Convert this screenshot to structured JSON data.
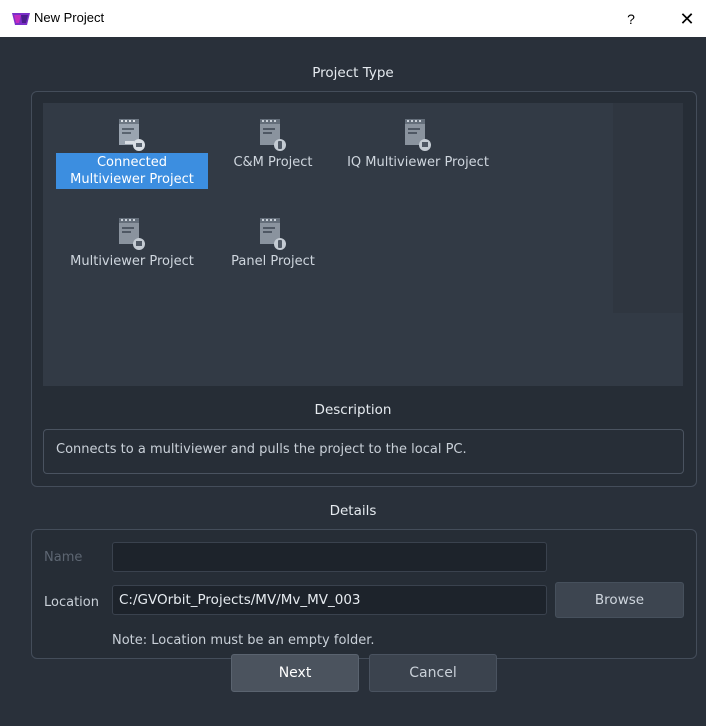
{
  "window": {
    "title": "New Project",
    "help_label": "?",
    "close_label": "✕"
  },
  "project_type": {
    "heading": "Project Type",
    "items": [
      {
        "label_line1": "Connected",
        "label_line2": "Multiviewer Project",
        "selected": true,
        "icon": "connected-document-icon"
      },
      {
        "label_line1": "C&M Project",
        "label_line2": "",
        "selected": false,
        "icon": "panel-document-icon"
      },
      {
        "label_line1": "IQ Multiviewer Project",
        "label_line2": "",
        "selected": false,
        "icon": "multiviewer-document-icon"
      },
      {
        "label_line1": "Multiviewer Project",
        "label_line2": "",
        "selected": false,
        "icon": "multiviewer-document-icon"
      },
      {
        "label_line1": "Panel Project",
        "label_line2": "",
        "selected": false,
        "icon": "panel-document-icon"
      }
    ]
  },
  "description": {
    "heading": "Description",
    "text": "Connects to a multiviewer and pulls the project to the local PC."
  },
  "details": {
    "heading": "Details",
    "name_label": "Name",
    "name_value": "",
    "location_label": "Location",
    "location_value": "C:/GVOrbit_Projects/MV/Mv_MV_003",
    "browse_label": "Browse",
    "note": "Note: Location must be an empty folder."
  },
  "actions": {
    "next_label": "Next",
    "cancel_label": "Cancel"
  },
  "colors": {
    "background": "#29303a",
    "selection": "#3c8ee0",
    "logo": "#8a2be2"
  }
}
